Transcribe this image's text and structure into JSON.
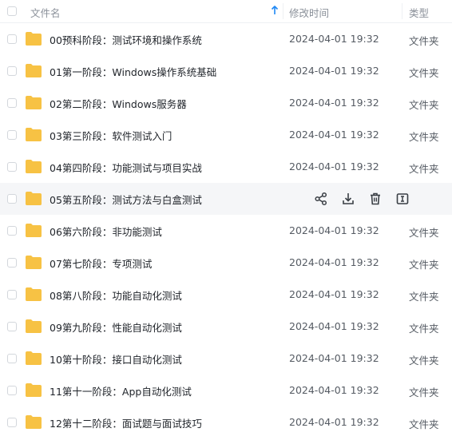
{
  "header": {
    "name_label": "文件名",
    "date_label": "修改时间",
    "type_label": "类型",
    "sort_direction": "ascending"
  },
  "folder_color": "#f7c244",
  "rows": [
    {
      "name": "00预科阶段：测试环境和操作系统",
      "date": "2024-04-01 19:32",
      "type": "文件夹"
    },
    {
      "name": "01第一阶段：Windows操作系统基础",
      "date": "2024-04-01 19:32",
      "type": "文件夹"
    },
    {
      "name": "02第二阶段：Windows服务器",
      "date": "2024-04-01 19:32",
      "type": "文件夹"
    },
    {
      "name": "03第三阶段：软件测试入门",
      "date": "2024-04-01 19:32",
      "type": "文件夹"
    },
    {
      "name": "04第四阶段：功能测试与项目实战",
      "date": "2024-04-01 19:32",
      "type": "文件夹"
    },
    {
      "name": "05第五阶段：测试方法与白盒测试",
      "hovered": true,
      "actions": [
        "share-icon",
        "download-icon",
        "delete-icon",
        "rename-icon"
      ]
    },
    {
      "name": "06第六阶段：非功能测试",
      "date": "2024-04-01 19:32",
      "type": "文件夹"
    },
    {
      "name": "07第七阶段：专项测试",
      "date": "2024-04-01 19:32",
      "type": "文件夹"
    },
    {
      "name": "08第八阶段：功能自动化测试",
      "date": "2024-04-01 19:32",
      "type": "文件夹"
    },
    {
      "name": "09第九阶段：性能自动化测试",
      "date": "2024-04-01 19:32",
      "type": "文件夹"
    },
    {
      "name": "10第十阶段：接口自动化测试",
      "date": "2024-04-01 19:32",
      "type": "文件夹"
    },
    {
      "name": "11第十一阶段：App自动化测试",
      "date": "2024-04-01 19:32",
      "type": "文件夹"
    },
    {
      "name": "12第十二阶段：面试题与面试技巧",
      "date": "2024-04-01 19:32",
      "type": "文件夹"
    }
  ]
}
